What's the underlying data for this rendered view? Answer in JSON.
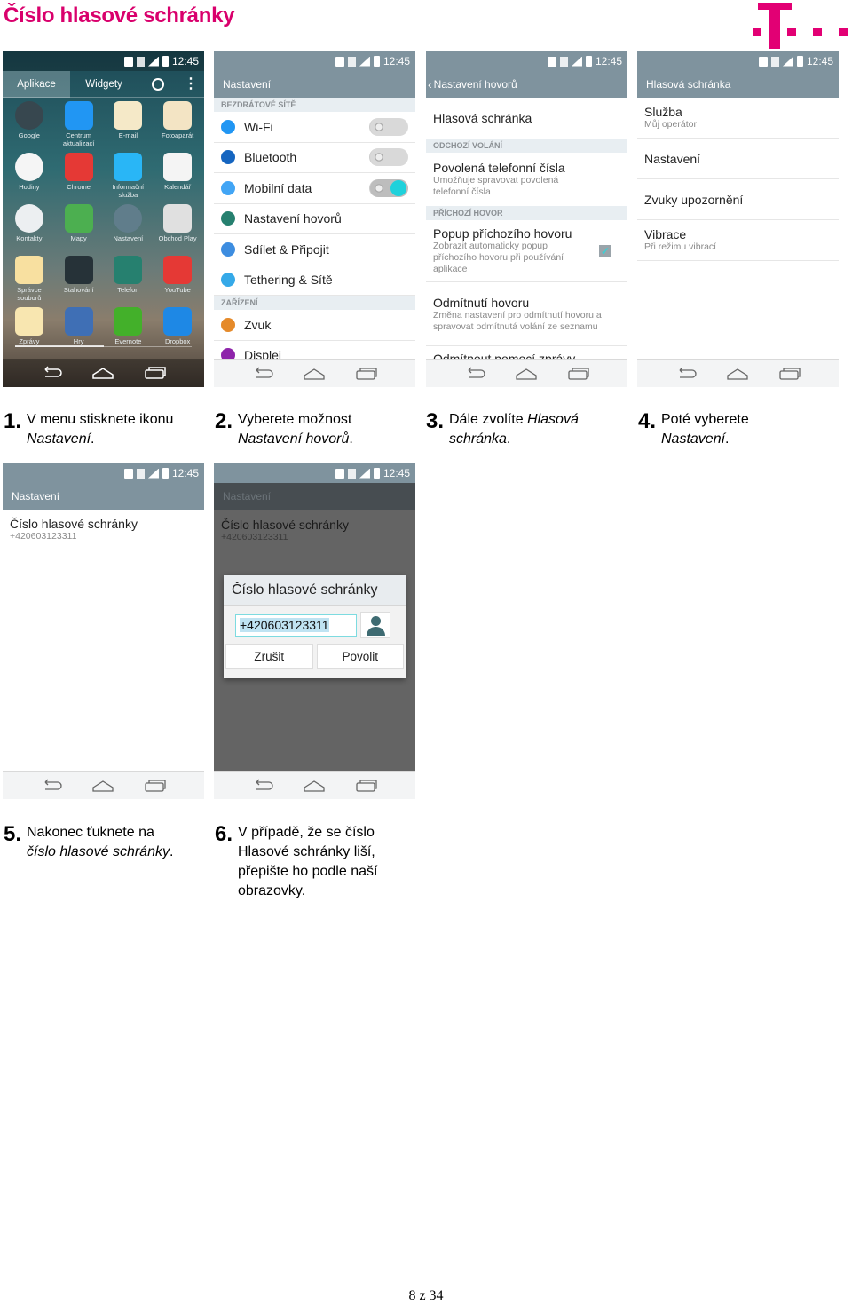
{
  "header": {
    "title": "Číslo hlasové schránky",
    "brand_color": "#e20074"
  },
  "status_time": "12:45",
  "screen1": {
    "tabs": [
      "Aplikace",
      "Widgety"
    ],
    "apps": [
      {
        "label": "Google",
        "color": "#37474f"
      },
      {
        "label": "Centrum aktualizací",
        "color": "#2196f3"
      },
      {
        "label": "E-mail",
        "color": "#f5e9c8"
      },
      {
        "label": "Fotoaparát",
        "color": "#f3e4c4"
      },
      {
        "label": "Hodiny",
        "color": "#f5f5f5"
      },
      {
        "label": "Chrome",
        "color": "#e53935"
      },
      {
        "label": "Informační služba",
        "color": "#29b6f6"
      },
      {
        "label": "Kalendář",
        "color": "#f4f4f4"
      },
      {
        "label": "Kontakty",
        "color": "#eceff1"
      },
      {
        "label": "Mapy",
        "color": "#4caf50"
      },
      {
        "label": "Nastavení",
        "color": "#607d8b"
      },
      {
        "label": "Obchod Play",
        "color": "#e0e0e0"
      },
      {
        "label": "Správce souborů",
        "color": "#f8e0a0"
      },
      {
        "label": "Stahování",
        "color": "#263238"
      },
      {
        "label": "Telefon",
        "color": "#26806f"
      },
      {
        "label": "YouTube",
        "color": "#e53935"
      },
      {
        "label": "Zprávy",
        "color": "#f8e6b0"
      },
      {
        "label": "Hry",
        "color": "#3f6fb5"
      },
      {
        "label": "Evernote",
        "color": "#43b02a"
      },
      {
        "label": "Dropbox",
        "color": "#1e88e5"
      }
    ]
  },
  "screen2": {
    "title": "Nastavení",
    "section1": "BEZDRÁTOVÉ SÍTĚ",
    "items1": [
      {
        "label": "Wi-Fi",
        "toggle": "off",
        "icon_color": "#2196f3"
      },
      {
        "label": "Bluetooth",
        "toggle": "off",
        "icon_color": "#1565c0"
      },
      {
        "label": "Mobilní data",
        "toggle": "on",
        "icon_color": "#42a5f5"
      },
      {
        "label": "Nastavení hovorů",
        "icon_color": "#26806f"
      },
      {
        "label": "Sdílet & Připojit",
        "icon_color": "#3d8de0"
      },
      {
        "label": "Tethering & Sítě",
        "icon_color": "#35a9e8"
      }
    ],
    "section2": "ZAŘÍZENÍ",
    "items2": [
      {
        "label": "Zvuk",
        "icon_color": "#e58a2a"
      },
      {
        "label": "Displej",
        "icon_color": "#8e24aa"
      }
    ]
  },
  "screen3": {
    "title": "Nastavení hovorů",
    "item_voicemail": "Hlasová schránka",
    "section1": "ODCHOZÍ VOLÁNÍ",
    "fdn_title": "Povolená telefonní čísla",
    "fdn_sub": "Umožňuje spravovat povolená telefonní čísla",
    "section2": "PŘÍCHOZÍ HOVOR",
    "popup_title": "Popup příchozího hovoru",
    "popup_sub": "Zobrazit automaticky popup příchozího hovoru při používání aplikace",
    "popup_checked": true,
    "reject_title": "Odmítnutí hovoru",
    "reject_sub": "Změna nastavení pro odmítnutí hovoru a spravovat odmítnutá volání ze seznamu",
    "cut_item": "Odmítnout pomocí zprávy"
  },
  "screen4": {
    "title": "Hlasová schránka",
    "items": [
      {
        "title": "Služba",
        "sub": "Můj operátor"
      },
      {
        "title": "Nastavení",
        "sub": ""
      },
      {
        "title": "Zvuky upozornění",
        "sub": ""
      },
      {
        "title": "Vibrace",
        "sub": "Při režimu vibrací"
      }
    ]
  },
  "screen5": {
    "title": "Nastavení",
    "item_title": "Číslo hlasové schránky",
    "item_value": "+420603123311"
  },
  "screen6": {
    "title": "Nastavení",
    "item_title": "Číslo hlasové schránky",
    "item_value": "+420603123311",
    "dialog_title": "Číslo hlasové schránky",
    "input_value": "+420603123311",
    "cancel": "Zrušit",
    "ok": "Povolit"
  },
  "steps": [
    {
      "num": "1.",
      "line1": "V menu stisknete ikonu",
      "line2_italic": "Nastavení",
      "line2_tail": "."
    },
    {
      "num": "2.",
      "line1": "Vyberete možnost",
      "line2_italic": "Nastavení hovorů",
      "line2_tail": "."
    },
    {
      "num": "3.",
      "line1_plain": "Dále zvolíte ",
      "line1_italic": "Hlasová",
      "line2_italic": "schránka",
      "line2_tail": "."
    },
    {
      "num": "4.",
      "line1": "Poté vyberete",
      "line2_italic": "Nastavení",
      "line2_tail": "."
    },
    {
      "num": "5.",
      "line1": "Nakonec ťuknete na",
      "line2_italic": "číslo hlasové schránky",
      "line2_tail": "."
    },
    {
      "num": "6.",
      "lines": [
        "V případě, že se číslo",
        "Hlasové schránky liší,",
        "přepište ho podle naší",
        "obrazovky."
      ]
    }
  ],
  "footer": {
    "page": "8 z 34"
  }
}
